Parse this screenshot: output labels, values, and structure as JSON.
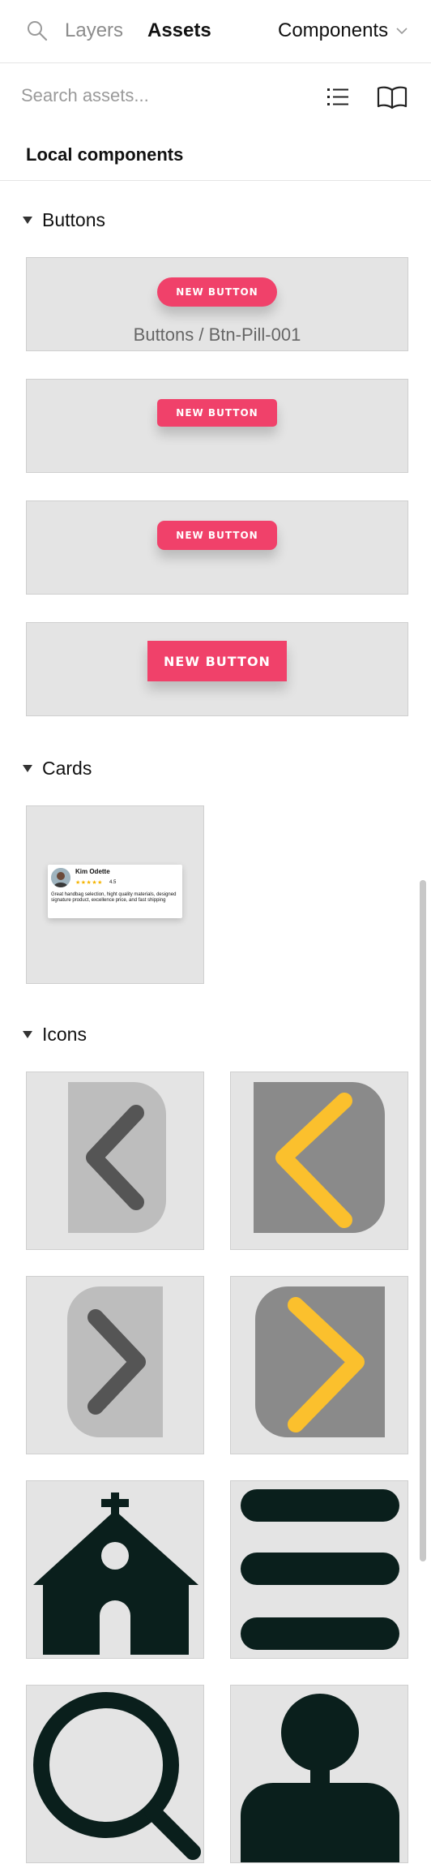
{
  "header": {
    "tab_layers": "Layers",
    "tab_assets": "Assets",
    "components_dropdown": "Components"
  },
  "search": {
    "placeholder": "Search assets..."
  },
  "local_components": {
    "title": "Local components"
  },
  "groups": {
    "buttons": {
      "title": "Buttons",
      "items": [
        {
          "label": "NEW BUTTON",
          "caption": "Buttons / Btn-Pill-001"
        },
        {
          "label": "NEW BUTTON"
        },
        {
          "label": "NEW BUTTON"
        },
        {
          "label": "NEW BUTTON"
        }
      ]
    },
    "cards": {
      "title": "Cards",
      "items": [
        {
          "name": "Kim Odette",
          "stars": "★★★★★",
          "rating": "4.5",
          "review": "Great handbag selection, hight quality materials, designed signature product, excellence price, and fast shipping"
        }
      ]
    },
    "icons": {
      "title": "Icons",
      "items": [
        {
          "icon": "chevron-left-gray-icon"
        },
        {
          "icon": "chevron-left-yellow-icon"
        },
        {
          "icon": "chevron-right-gray-icon"
        },
        {
          "icon": "chevron-right-yellow-icon"
        },
        {
          "icon": "church-icon"
        },
        {
          "icon": "menu-icon"
        },
        {
          "icon": "search-icon"
        },
        {
          "icon": "user-icon"
        }
      ]
    }
  },
  "colors": {
    "accent_pink": "#f0416a",
    "icon_dark": "#0a1f1c",
    "icon_gray": "#555555",
    "icon_yellow": "#fbc02d",
    "tile_bg": "#e4e4e4"
  }
}
